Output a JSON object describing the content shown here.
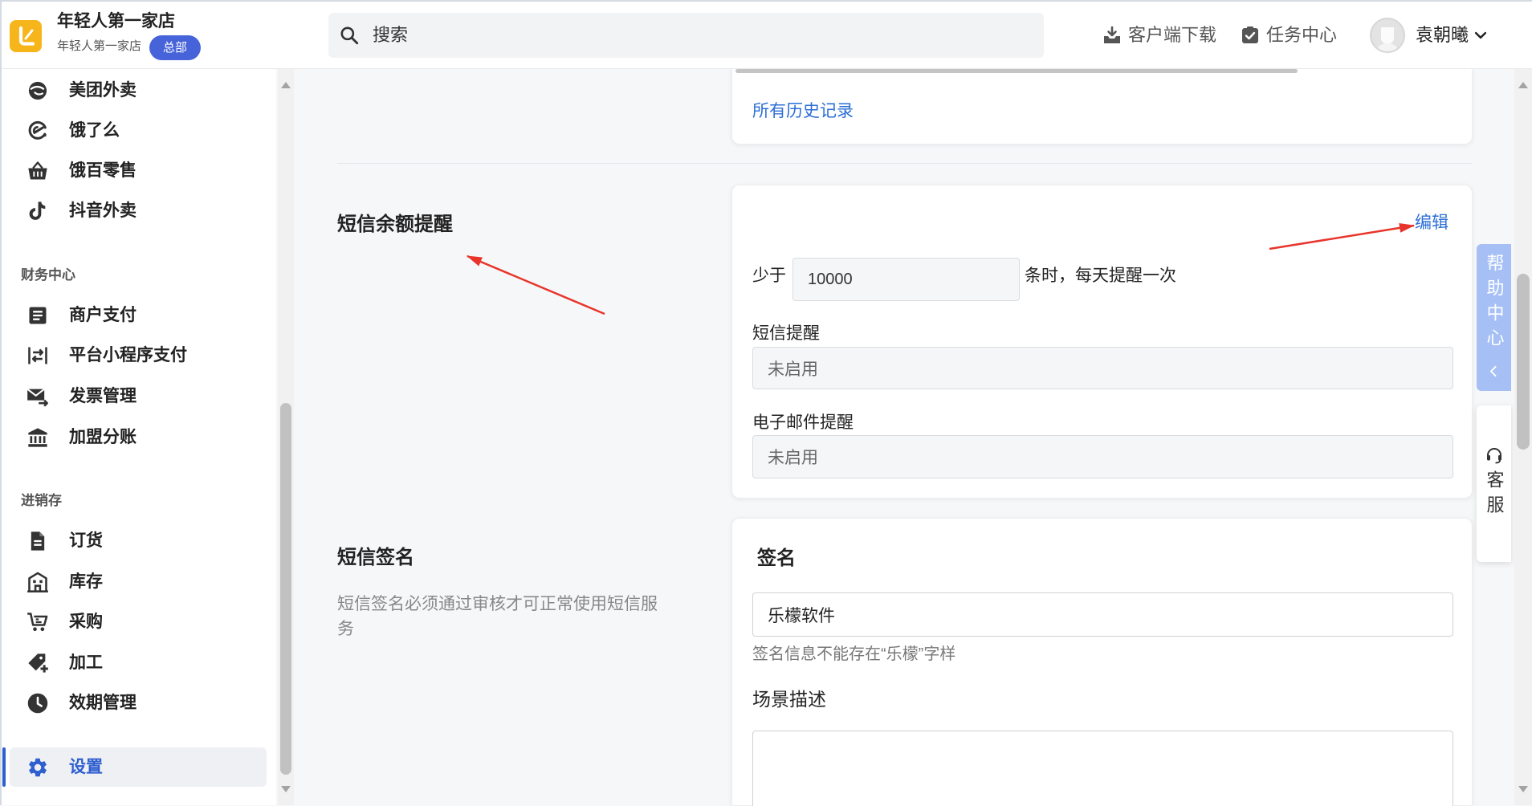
{
  "app": {
    "logo_icon": "brand-logo-icon",
    "store_name": "年轻人第一家店",
    "store_subtitle": "年轻人第一家店",
    "badge": "总部"
  },
  "search": {
    "icon": "search-icon",
    "placeholder": "搜索"
  },
  "header": {
    "download": {
      "icon": "download-icon",
      "label": "客户端下载"
    },
    "tasks": {
      "icon": "task-check-icon",
      "label": "任务中心"
    },
    "user": {
      "avatar": "avatar-icon",
      "name": "袁朝曦",
      "menu_icon": "chevron-down-icon"
    }
  },
  "sidebar": {
    "top": [
      {
        "label": "美团外卖",
        "icon": "meituan-icon"
      },
      {
        "label": "饿了么",
        "icon": "eleme-icon"
      },
      {
        "label": "饿百零售",
        "icon": "basket-icon"
      },
      {
        "label": "抖音外卖",
        "icon": "douyin-icon"
      }
    ],
    "finance": {
      "title": "财务中心",
      "items": [
        {
          "label": "商户支付",
          "icon": "document-list-icon"
        },
        {
          "label": "平台小程序支付",
          "icon": "exchange-icon"
        },
        {
          "label": "发票管理",
          "icon": "invoice-mail-icon"
        },
        {
          "label": "加盟分账",
          "icon": "bank-icon"
        }
      ]
    },
    "inventory": {
      "title": "进销存",
      "items": [
        {
          "label": "订货",
          "icon": "file-icon"
        },
        {
          "label": "库存",
          "icon": "warehouse-icon"
        },
        {
          "label": "采购",
          "icon": "cart-icon"
        },
        {
          "label": "加工",
          "icon": "tag-plus-icon"
        },
        {
          "label": "效期管理",
          "icon": "clock-icon"
        }
      ]
    },
    "settings": {
      "label": "设置",
      "icon": "gear-icon",
      "active": true
    }
  },
  "history": {
    "link": "所有历史记录"
  },
  "sms_balance": {
    "title": "短信余额提醒",
    "edit": "编辑",
    "less_than": "少于",
    "threshold": "10000",
    "suffix": "条时，每天提醒一次",
    "sms_label": "短信提醒",
    "sms_value": "未启用",
    "email_label": "电子邮件提醒",
    "email_value": "未启用"
  },
  "sms_signature": {
    "title": "短信签名",
    "description": "短信签名必须通过审核才可正常使用短信服务",
    "card_title": "签名",
    "value": "乐檬软件",
    "hint": "签名信息不能存在“乐檬”字样",
    "scene_label": "场景描述"
  },
  "help_panel": {
    "title": "帮助中心",
    "collapse_icon": "chevron-left-icon"
  },
  "service_panel": {
    "title": "客服",
    "icon": "headset-icon"
  },
  "colors": {
    "accent": "#2b6fd6",
    "brand": "#f7b51c",
    "badge": "#4763d9",
    "help": "#a6c0f5",
    "active": "#2f5fcf",
    "annotation": "#e8352b"
  }
}
